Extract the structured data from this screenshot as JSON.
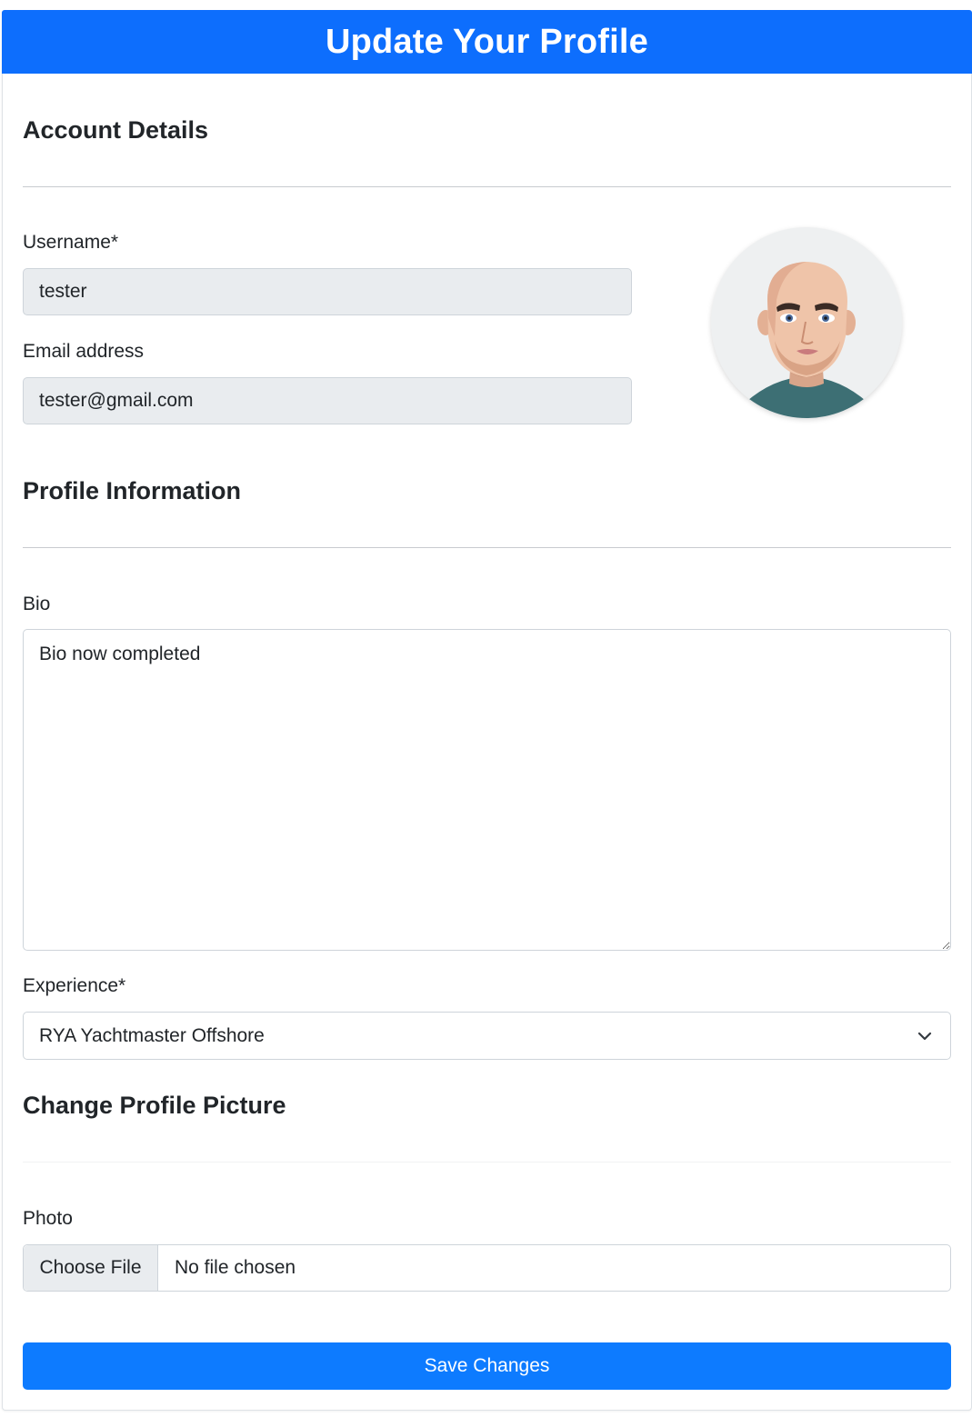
{
  "header": {
    "title": "Update Your Profile"
  },
  "account": {
    "section_title": "Account Details",
    "username_label": "Username*",
    "username_value": "tester",
    "email_label": "Email address",
    "email_value": "tester@gmail.com"
  },
  "profile": {
    "section_title": "Profile Information",
    "bio_label": "Bio",
    "bio_value": "Bio now completed",
    "experience_label": "Experience*",
    "experience_selected": "RYA Yachtmaster Offshore"
  },
  "picture": {
    "section_title": "Change Profile Picture",
    "photo_label": "Photo",
    "choose_file_label": "Choose File",
    "no_file_text": "No file chosen"
  },
  "actions": {
    "save_label": "Save Changes"
  },
  "colors": {
    "primary": "#0d6efd",
    "readonly_bg": "#e9ecef",
    "avatar_shirt": "#3d6f74"
  },
  "icons": {
    "select_caret": "chevron-down-icon",
    "avatar": "avatar-illustration"
  }
}
